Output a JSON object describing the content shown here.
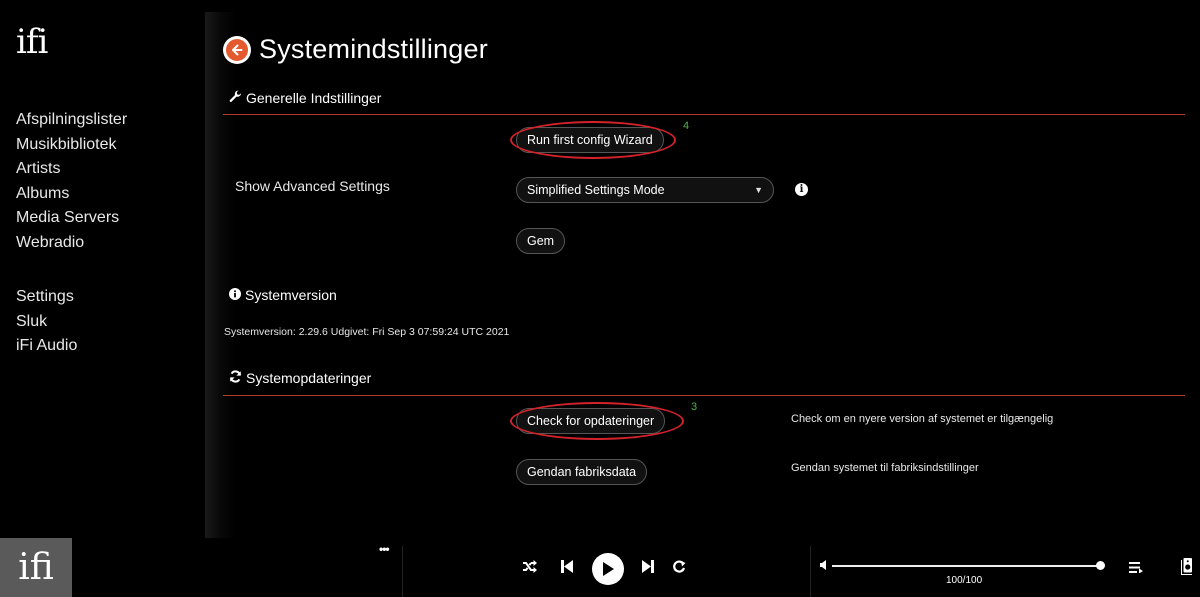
{
  "brand": {
    "logo": "ifi"
  },
  "sidebar": {
    "group1": [
      "Afspilningslister",
      "Musikbibliotek",
      "Artists",
      "Albums",
      "Media Servers",
      "Webradio"
    ],
    "group2": [
      "Settings",
      "Sluk",
      "iFi Audio"
    ]
  },
  "page": {
    "title": "Systemindstillinger",
    "general": {
      "heading": "Generelle Indstillinger",
      "wizard_button": "Run first config Wizard",
      "wizard_annotation": "4",
      "advanced_label": "Show Advanced Settings",
      "mode_select": "Simplified Settings Mode",
      "save_button": "Gem"
    },
    "version": {
      "heading": "Systemversion",
      "text": "Systemversion: 2.29.6 Udgivet: Fri Sep 3 07:59:24 UTC 2021"
    },
    "updates": {
      "heading": "Systemopdateringer",
      "check_button": "Check for opdateringer",
      "check_annotation": "3",
      "check_desc": "Check om en nyere version af systemet er tilgængelig",
      "restore_button": "Gendan fabriksdata",
      "restore_desc": "Gendan systemet til fabriksindstillinger"
    }
  },
  "player": {
    "more": "•••",
    "volume": 100,
    "volume_text": "100/100"
  },
  "colors": {
    "accent": "#e35a2f",
    "divider": "#b33a2a",
    "annotation": "#d3222a",
    "annotation_number": "#4caf50"
  }
}
